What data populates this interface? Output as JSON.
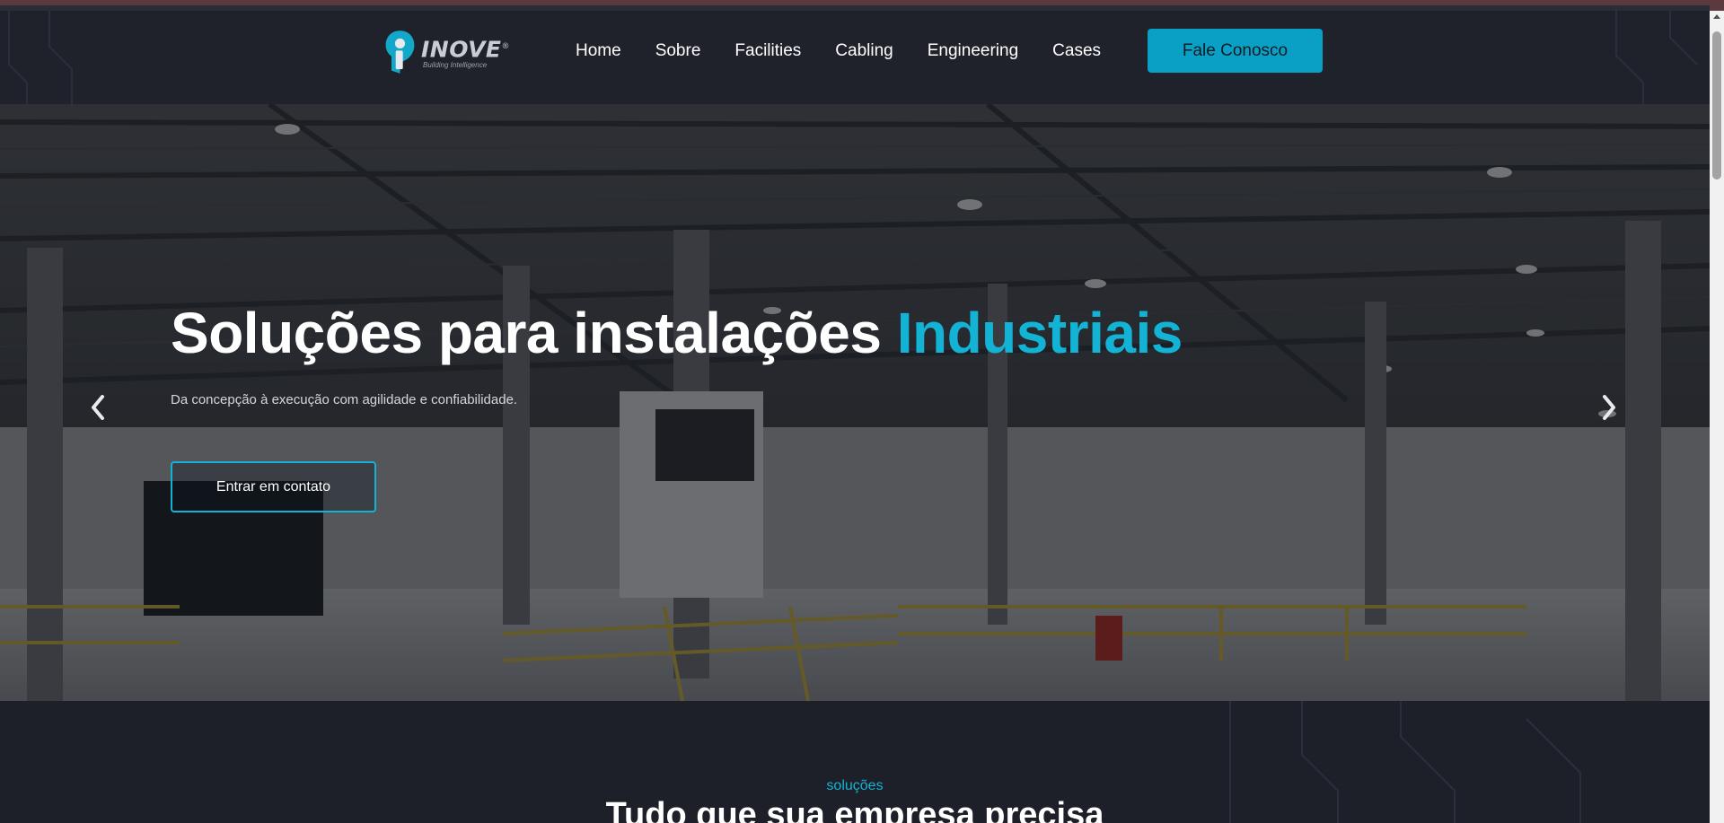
{
  "brand": {
    "name": "INOVE",
    "registered": "®",
    "tagline": "Building Intelligence",
    "accent_color": "#13b3d6",
    "button_color": "#0aa0c5"
  },
  "nav": {
    "items": [
      {
        "label": "Home"
      },
      {
        "label": "Sobre"
      },
      {
        "label": "Facilities"
      },
      {
        "label": "Cabling"
      },
      {
        "label": "Engineering"
      },
      {
        "label": "Cases"
      }
    ],
    "cta_label": "Fale Conosco"
  },
  "hero": {
    "title_main": "Soluções para instalações",
    "title_accent": "Industriais",
    "subtitle": "Da concepção à execução com agilidade e confiabilidade.",
    "button_label": "Entrar em contato",
    "prev_icon": "chevron-left-icon",
    "next_icon": "chevron-right-icon"
  },
  "solutions": {
    "eyebrow": "soluções",
    "title": "Tudo que sua empresa precisa"
  }
}
